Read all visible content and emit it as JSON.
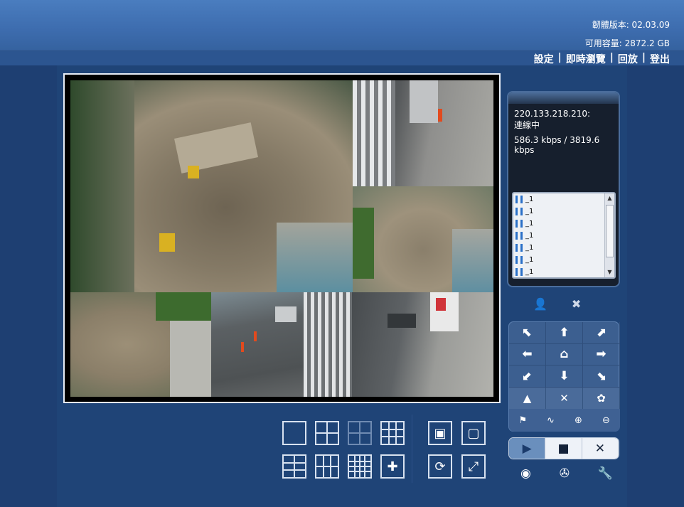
{
  "header": {
    "firmware": "韌體版本: 02.03.09",
    "capacity": "可用容量: 2872.2 GB"
  },
  "nav": {
    "settings": "設定",
    "live": "即時瀏覽",
    "playback": "回放",
    "logout": "登出",
    "separator": "|"
  },
  "status": {
    "ip": "220.133.218.210:",
    "state": "連線中",
    "bitrate": "586.3 kbps / 3819.6 kbps"
  },
  "channels": [
    {
      "label": "_1"
    },
    {
      "label": "_1"
    },
    {
      "label": "_1"
    },
    {
      "label": "_1"
    },
    {
      "label": "_1"
    },
    {
      "label": "_1"
    },
    {
      "label": "_1"
    }
  ],
  "colors": {
    "accent_selected": "#22c24a",
    "background": "#1e3f72"
  },
  "icons": {
    "ptz": [
      "arrow-up-left",
      "arrow-up",
      "arrow-up-right",
      "arrow-left",
      "home",
      "arrow-right",
      "arrow-down-left",
      "arrow-down",
      "arrow-down-right"
    ],
    "ptz_row2": [
      "mountain",
      "focus-cross",
      "flower-macro"
    ],
    "ptz_row3": [
      "preset",
      "patrol",
      "zoom-in",
      "zoom-out"
    ],
    "playback": [
      "play",
      "stop",
      "close"
    ],
    "bottom": [
      "record",
      "film-reel",
      "wrench"
    ]
  }
}
